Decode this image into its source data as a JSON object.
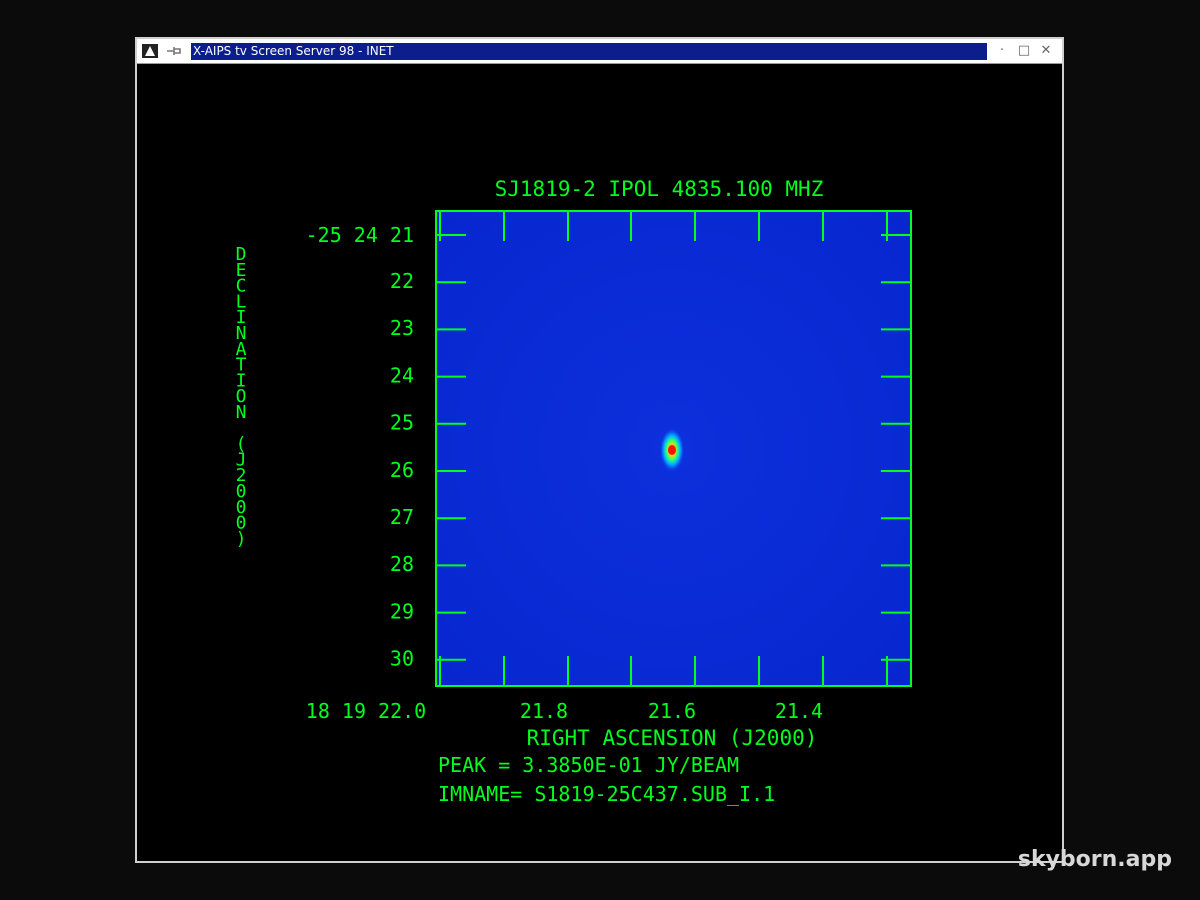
{
  "window": {
    "title": "X-AIPS tv Screen Server 98 - INET",
    "icons": [
      "app-icon",
      "pin-icon"
    ],
    "controls": [
      "minimize-icon",
      "maximize-icon",
      "close-icon"
    ]
  },
  "plot": {
    "title": "SJ1819-2  IPOL   4835.100 MHZ",
    "ylabel": "DECLINATION (J2000)",
    "xlabel": "RIGHT ASCENSION (J2000)",
    "peak_text": "PEAK =   3.3850E-01 JY/BEAM",
    "imname_text": "IMNAME= S1819-25C437.SUB_I.1",
    "ytick_first": "-25 24 21",
    "yticks": [
      "22",
      "23",
      "24",
      "25",
      "26",
      "27",
      "28",
      "29",
      "30"
    ],
    "xtick_first": "18 19 22.0",
    "xticks": [
      "21.8",
      "21.6",
      "21.4"
    ],
    "text_color": "#00ff1e",
    "image_color": "#0a2cd8"
  },
  "watermark": "skyborn.app"
}
